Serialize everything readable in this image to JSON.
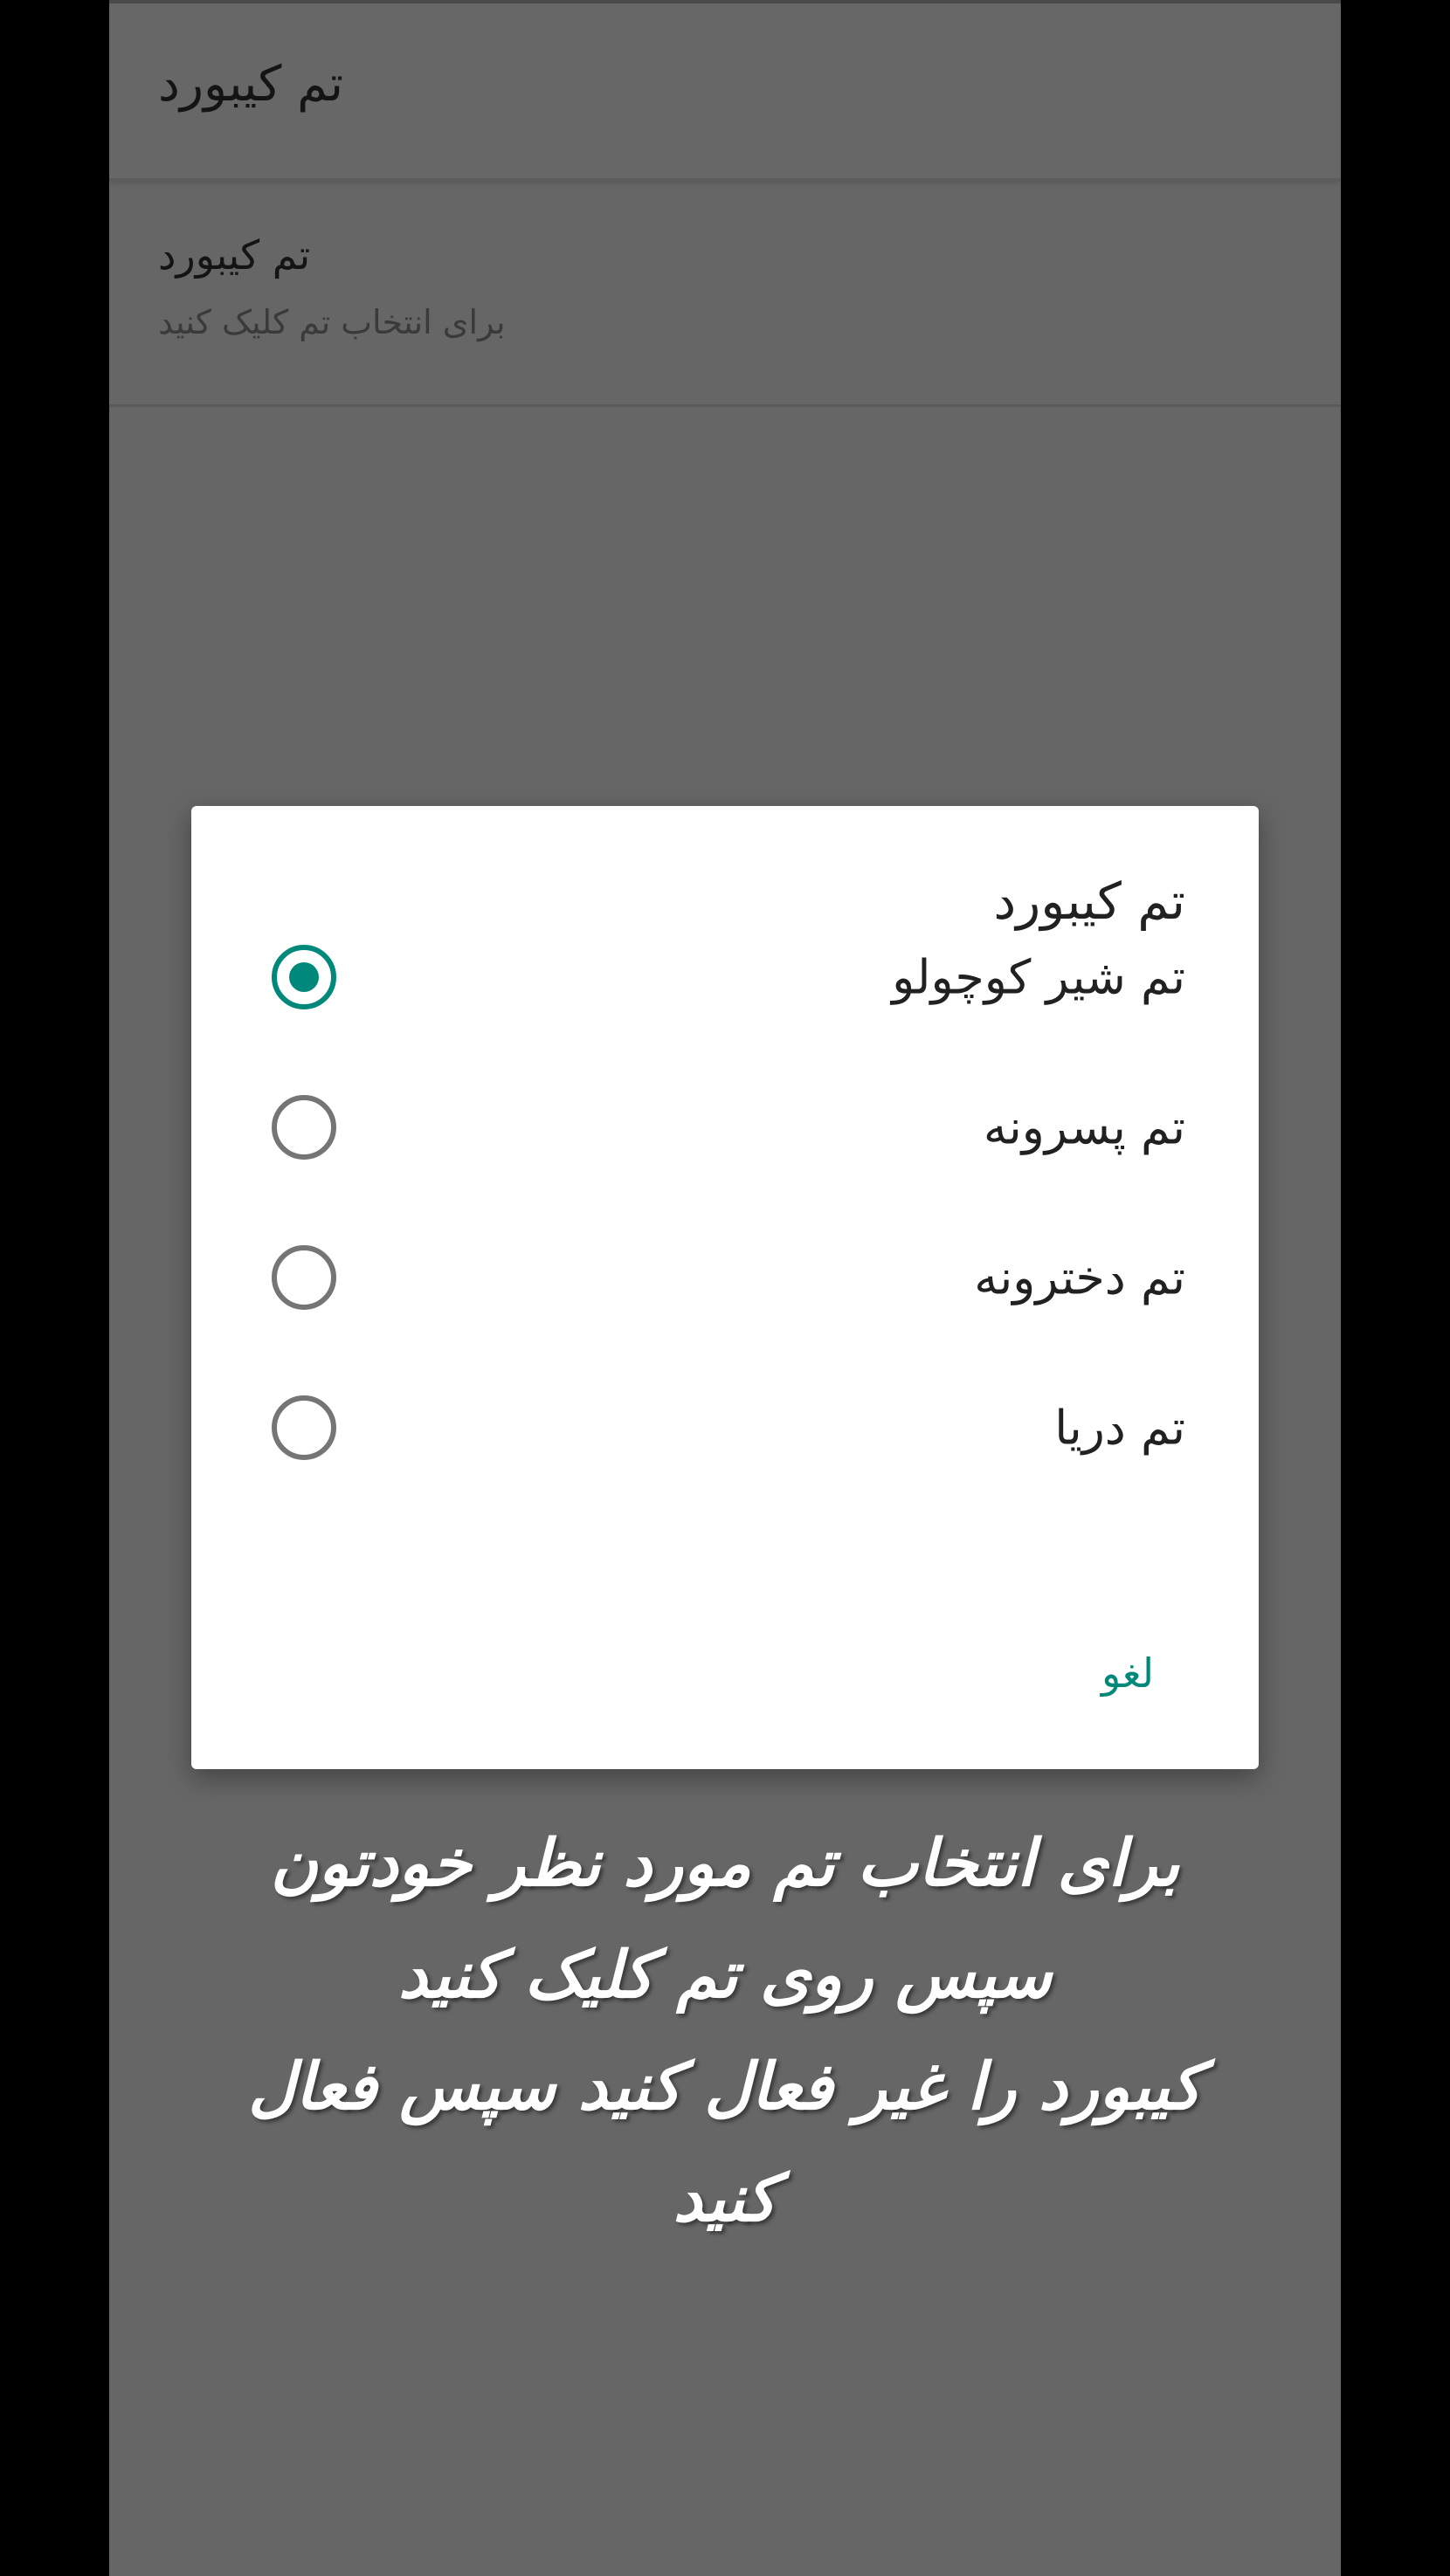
{
  "app_bar": {
    "title": "تم کیبورد"
  },
  "preference": {
    "title": "تم کیبورد",
    "summary": "برای انتخاب تم کلیک کنید"
  },
  "dialog": {
    "title": "تم کیبورد",
    "options": [
      {
        "label": "تم شیر کوچولو",
        "selected": true
      },
      {
        "label": "تم پسرونه",
        "selected": false
      },
      {
        "label": "تم دخترونه",
        "selected": false
      },
      {
        "label": "تم دریا",
        "selected": false
      }
    ],
    "cancel_label": "لغو"
  },
  "overlay_caption": {
    "lines": [
      "برای انتخاب تم مورد نظر خودتون",
      "سپس روی تم کلیک کنید",
      "کیبورد را غیر فعال کنید سپس فعال",
      "کنید"
    ]
  },
  "colors": {
    "accent": "#00897b",
    "scrim": "#666666",
    "dialog_background": "#ffffff",
    "caption_text": "#ffffff"
  }
}
